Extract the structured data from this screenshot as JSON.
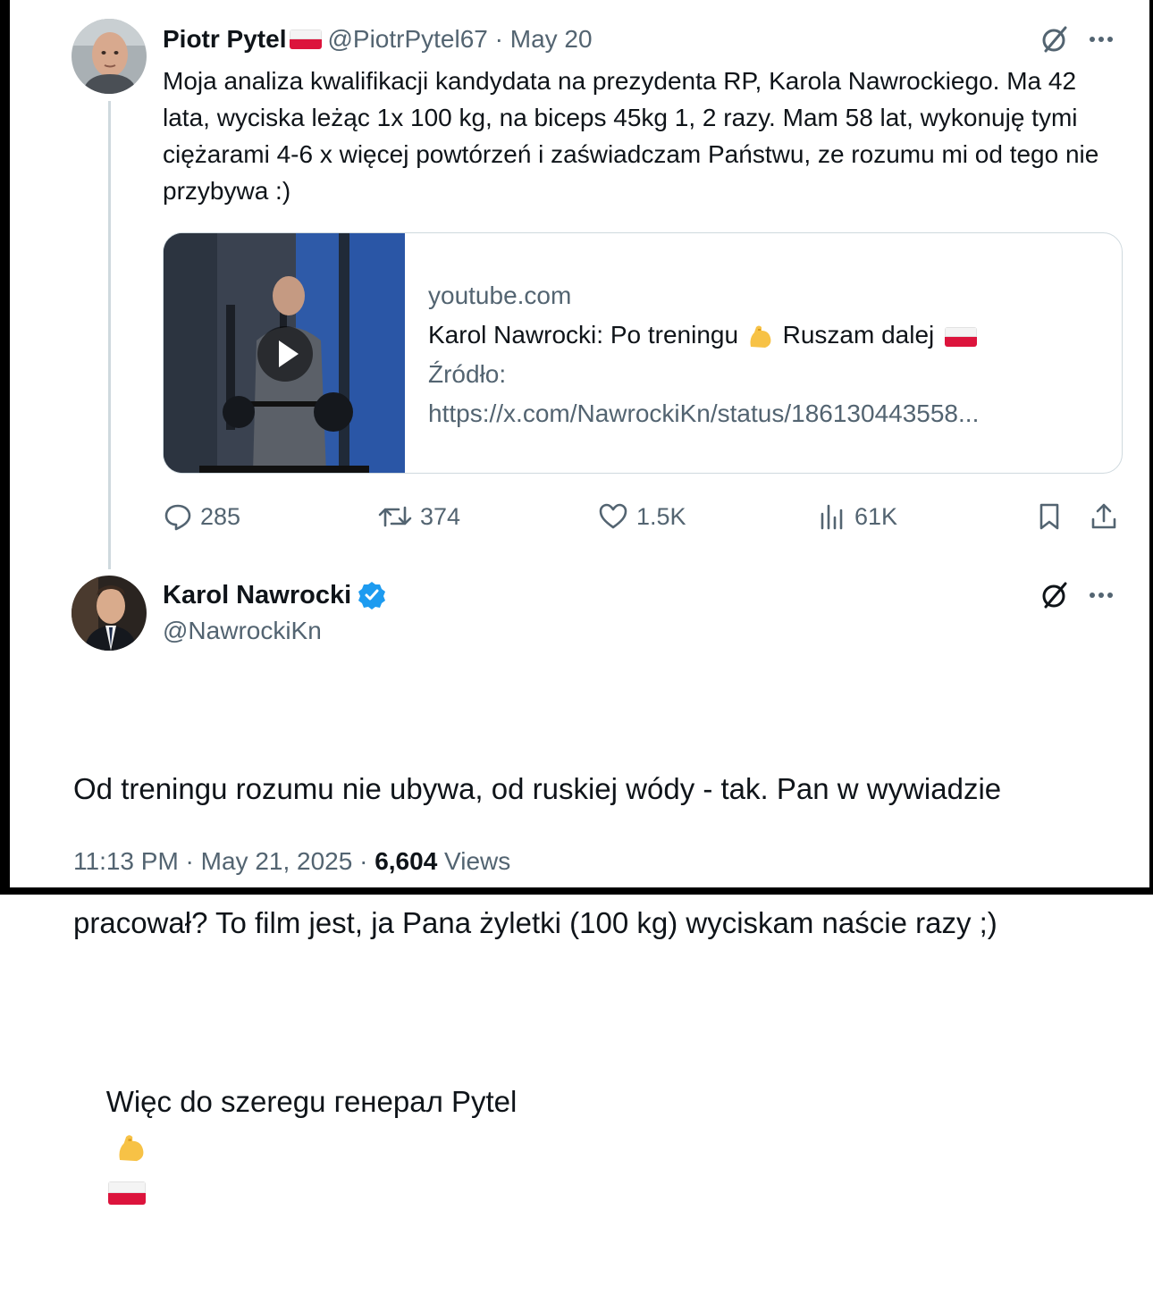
{
  "tweet1": {
    "author_name": "Piotr Pytel",
    "handle_date": "@PiotrPytel67 · May 20",
    "text": "Moja analiza kwalifikacji kandydata na prezydenta RP, Karola Nawrockiego. Ma 42 lata, wyciska leżąc 1x 100 kg, na biceps 45kg 1, 2 razy. Mam 58 lat, wykonuję tymi ciężarami 4-6 x więcej powtórzeń i zaświadczam Państwu, ze rozumu mi od tego nie przybywa :)",
    "card": {
      "domain": "youtube.com",
      "title": "Karol Nawrocki: Po treningu",
      "title_after": "Ruszam dalej",
      "source_label": "Źródło:",
      "source_url": "https://x.com/NawrockiKn/status/186130443558..."
    },
    "stats": {
      "replies": "285",
      "reposts": "374",
      "likes": "1.5K",
      "views": "61K"
    }
  },
  "tweet2": {
    "author_name": "Karol Nawrocki",
    "handle": "@NawrockiKn",
    "verified": true,
    "text_line1": "Od treningu rozumu nie ubywa, od ruskiej wódy - tak. Pan w wywiadzie",
    "text_line2": "pracował? To film jest, ja Pana żyletki (100 kg) wyciskam naście razy ;)",
    "text_line3": "Więc do szeregu генерал Pytel",
    "time_date": "11:13 PM · May 21, 2025 · ",
    "views_count": "6,604",
    "views_label": " Views"
  },
  "colors": {
    "text": "#0f1419",
    "muted": "#536471",
    "verified": "#1d9bf0",
    "border": "#cfd9de"
  },
  "icons": [
    "no-grok-icon",
    "more-icon",
    "reply-icon",
    "repost-icon",
    "like-icon",
    "views-icon",
    "bookmark-icon",
    "share-icon",
    "play-icon",
    "verified-badge-icon",
    "flexed-biceps-emoji",
    "poland-flag-emoji"
  ]
}
